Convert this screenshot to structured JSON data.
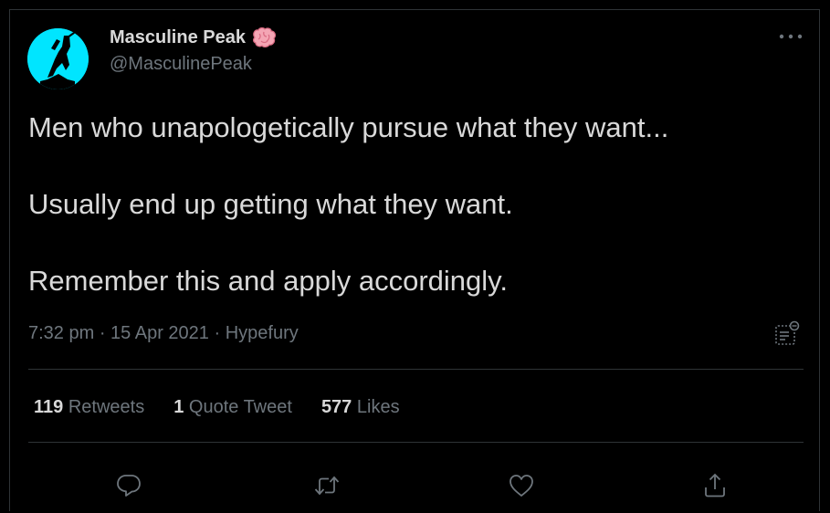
{
  "author": {
    "name": "Masculine Peak",
    "handle": "@MasculinePeak",
    "avatar_color": "#00e5ff",
    "badge_icon": "brain-emoji"
  },
  "tweet": {
    "paragraphs": [
      "Men who unapologetically pursue what they want...",
      "Usually end up getting what they want.",
      "Remember this and apply accordingly."
    ],
    "time": "7:32 pm",
    "date": "15 Apr 2021",
    "source": "Hypefury"
  },
  "stats": {
    "retweets_count": "119",
    "retweets_label": "Retweets",
    "quotes_count": "1",
    "quotes_label": "Quote Tweet",
    "likes_count": "577",
    "likes_label": "Likes"
  },
  "actions": [
    "reply-icon",
    "retweet-icon",
    "like-icon",
    "share-icon"
  ],
  "colors": {
    "background": "#000000",
    "text": "#d9d9d9",
    "muted": "#6e767d",
    "divider": "#2f3336"
  }
}
